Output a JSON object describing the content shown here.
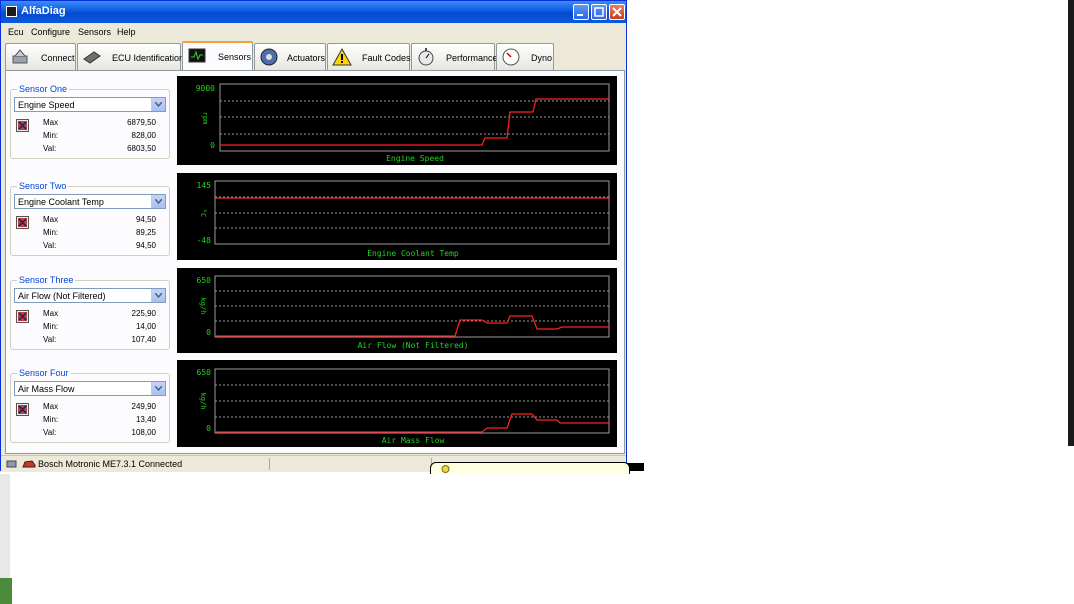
{
  "window": {
    "title": "AlfaDiag"
  },
  "menu": [
    "Ecu",
    "Configure",
    "Sensors",
    "Help"
  ],
  "tabs": [
    {
      "label": "Connect",
      "icon": "connect-icon"
    },
    {
      "label": "ECU Identification",
      "icon": "chip-icon"
    },
    {
      "label": "Sensors",
      "icon": "monitor-icon",
      "active": true
    },
    {
      "label": "Actuators",
      "icon": "gear-icon"
    },
    {
      "label": "Fault Codes",
      "icon": "warning-icon"
    },
    {
      "label": "Performance",
      "icon": "stopwatch-icon"
    },
    {
      "label": "Dyno",
      "icon": "gauge-icon"
    }
  ],
  "sensors": [
    {
      "group": "Sensor One",
      "selected": "Engine Speed",
      "max": "6879,50",
      "min": "828,00",
      "val": "6803,50"
    },
    {
      "group": "Sensor Two",
      "selected": "Engine Coolant Temp",
      "max": "94,50",
      "min": "89,25",
      "val": "94,50"
    },
    {
      "group": "Sensor Three",
      "selected": "Air Flow (Not Filtered)",
      "max": "225,90",
      "min": "14,00",
      "val": "107,40"
    },
    {
      "group": "Sensor Four",
      "selected": "Air Mass Flow",
      "max": "249,90",
      "min": "13,40",
      "val": "108,00"
    }
  ],
  "stat_labels": {
    "max": "Max",
    "min": "Min:",
    "val": "Val:"
  },
  "graphs": [
    {
      "title": "Engine Speed",
      "unit": "rpm",
      "ymax": "9000",
      "ymin": "0"
    },
    {
      "title": "Engine Coolant Temp",
      "unit": "°C",
      "ymax": "145",
      "ymin": "-48"
    },
    {
      "title": "Air Flow (Not Filtered)",
      "unit": "kg/h",
      "ymax": "650",
      "ymin": "0"
    },
    {
      "title": "Air Mass Flow",
      "unit": "kg/h",
      "ymax": "650",
      "ymin": "0"
    }
  ],
  "status": {
    "text": "Bosch Motronic ME7.3.1 Connected"
  },
  "colors": {
    "trace": "#ff2020",
    "grid": "#9a9a9a",
    "label": "#1fd41f",
    "titlebar": "#0a5be0"
  }
}
